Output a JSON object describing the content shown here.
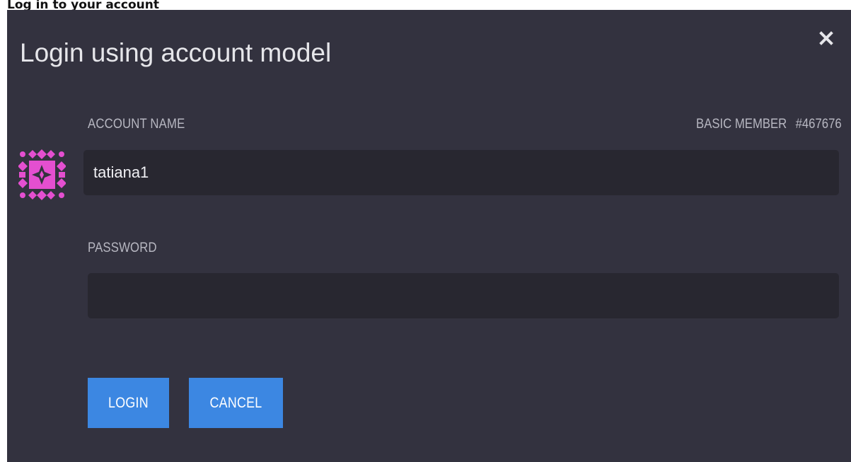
{
  "page": {
    "heading": "Log in to your account"
  },
  "dialog": {
    "title": "Login using account model",
    "close_icon": "close-icon",
    "account": {
      "label": "ACCOUNT NAME",
      "value": "tatiana1",
      "membership": "BASIC MEMBER",
      "member_id": "#467676",
      "avatar_icon": "geometric-avatar-icon",
      "avatar_color": "#e44fd0"
    },
    "password": {
      "label": "PASSWORD",
      "value": ""
    },
    "buttons": {
      "login_label": "LOGIN",
      "cancel_label": "CANCEL"
    }
  },
  "colors": {
    "dialog_bg": "#33323f",
    "input_bg": "#282730",
    "button_bg": "#3c87e2",
    "title_text": "#e6e6ea",
    "label_text": "#b7b7c1"
  }
}
